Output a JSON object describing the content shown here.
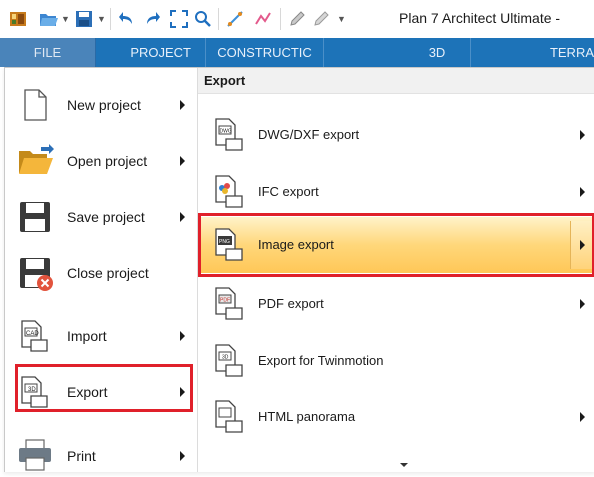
{
  "window": {
    "title": "Plan 7 Architect Ultimate - "
  },
  "toolbar": {
    "icons": [
      "app-logo-icon",
      "folder-open-icon",
      "save-icon",
      "undo-icon",
      "redo-icon",
      "zoom-extents-icon",
      "zoom-icon",
      "measure-icon",
      "line-tool-icon",
      "pencil-icon",
      "brush-icon",
      "customize-dropdown-icon"
    ]
  },
  "ribbon": {
    "tabs": [
      "FILE",
      "PROJECT",
      "CONSTRUCTIC",
      "3D",
      "TERRA"
    ],
    "active_tab": "FILE",
    "color": "#1d73b8"
  },
  "file_menu": {
    "items": [
      {
        "label": "New project",
        "icon": "new-document-icon",
        "submenu": true
      },
      {
        "label": "Open project",
        "icon": "open-folder-icon",
        "submenu": true
      },
      {
        "label": "Save project",
        "icon": "save-disk-icon",
        "submenu": true
      },
      {
        "label": "Close project",
        "icon": "close-project-icon",
        "submenu": false
      },
      {
        "label": "Import",
        "icon": "import-icon",
        "submenu": true
      },
      {
        "label": "Export",
        "icon": "export-icon",
        "submenu": true,
        "highlighted": true
      },
      {
        "label": "Print",
        "icon": "printer-icon",
        "submenu": true
      }
    ]
  },
  "export_submenu": {
    "header": "Export",
    "items": [
      {
        "label": "DWG/DXF export",
        "icon": "dwg-export-icon",
        "submenu": true
      },
      {
        "label": "IFC export",
        "icon": "ifc-export-icon",
        "submenu": true
      },
      {
        "label": "Image export",
        "icon": "image-export-icon",
        "submenu": true,
        "selected": true
      },
      {
        "label": "PDF export",
        "icon": "pdf-export-icon",
        "submenu": true
      },
      {
        "label": "Export for Twinmotion",
        "icon": "twinmotion-export-icon",
        "submenu": false
      },
      {
        "label": "HTML panorama",
        "icon": "html-panorama-icon",
        "submenu": true
      }
    ]
  },
  "highlight_color": "#e0202a"
}
